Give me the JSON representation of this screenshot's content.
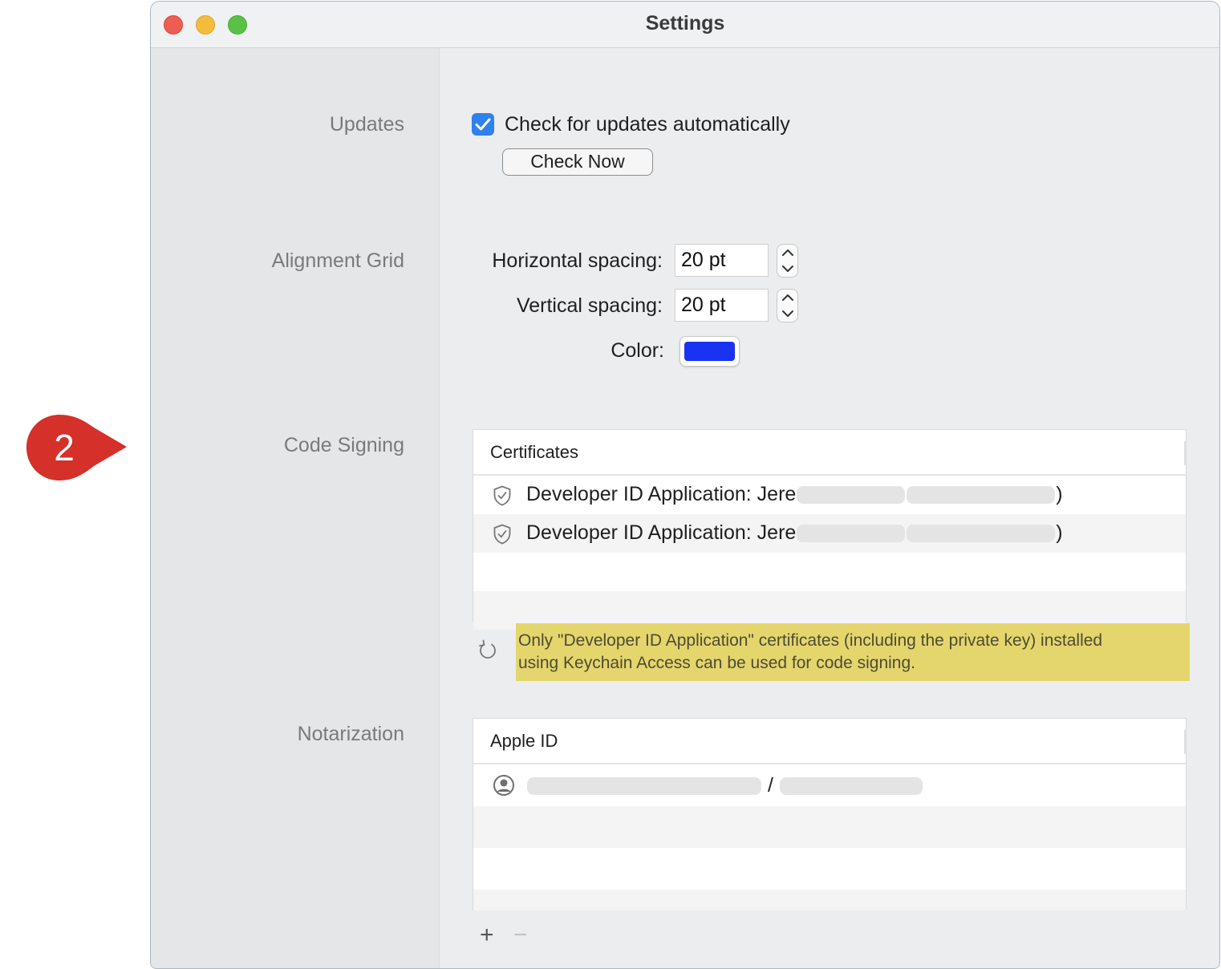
{
  "callout": {
    "number": "2"
  },
  "window": {
    "title": "Settings"
  },
  "sections": {
    "updates": "Updates",
    "alignment_grid": "Alignment Grid",
    "code_signing": "Code Signing",
    "notarization": "Notarization"
  },
  "updates": {
    "auto_check_label": "Check for updates automatically",
    "auto_check_checked": true,
    "check_now_label": "Check Now"
  },
  "alignment": {
    "horizontal_label": "Horizontal spacing:",
    "horizontal_value": "20 pt",
    "vertical_label": "Vertical spacing:",
    "vertical_value": "20 pt",
    "color_label": "Color:",
    "color_value": "#1a33f2"
  },
  "code_signing": {
    "column_header": "Certificates",
    "certificates": [
      {
        "prefix": "Developer ID Application: Jere",
        "suffix": ")"
      },
      {
        "prefix": "Developer ID Application: Jere",
        "suffix": ")"
      }
    ],
    "notice_line1": "Only \"Developer ID Application\" certificates (including the private key) installed",
    "notice_line2": "using Keychain Access can be used for code signing."
  },
  "notarization": {
    "column_header": "Apple ID",
    "accounts": [
      {
        "separator": "/"
      }
    ],
    "add_label": "+",
    "remove_label": "−"
  },
  "colors": {
    "accent": "#2f80f0",
    "callout": "#d5302a",
    "notice_bg": "#e4d66c"
  },
  "icons": [
    "close-icon",
    "minimize-icon",
    "zoom-icon",
    "checkmark-icon",
    "chevron-up-icon",
    "chevron-down-icon",
    "shield-check-icon",
    "refresh-icon",
    "person-circle-icon",
    "plus-icon",
    "minus-icon"
  ]
}
